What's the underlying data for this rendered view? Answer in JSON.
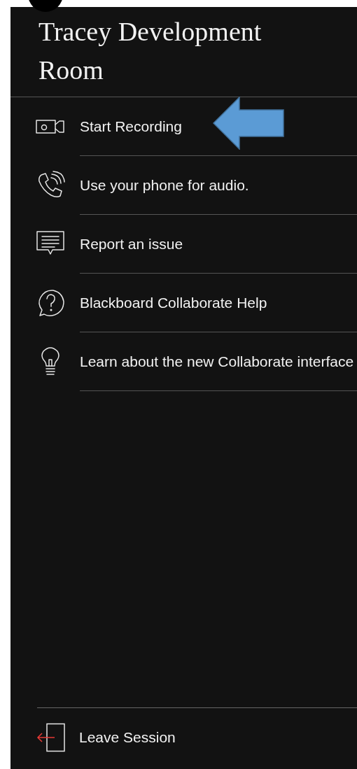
{
  "room_title": "Tracey Development Room",
  "menu_items": [
    {
      "label": "Start Recording"
    },
    {
      "label": "Use your phone for audio."
    },
    {
      "label": "Report an issue"
    },
    {
      "label": "Blackboard Collaborate Help"
    },
    {
      "label": "Learn about the new Collaborate interface"
    }
  ],
  "leave_session": {
    "label": "Leave Session"
  }
}
